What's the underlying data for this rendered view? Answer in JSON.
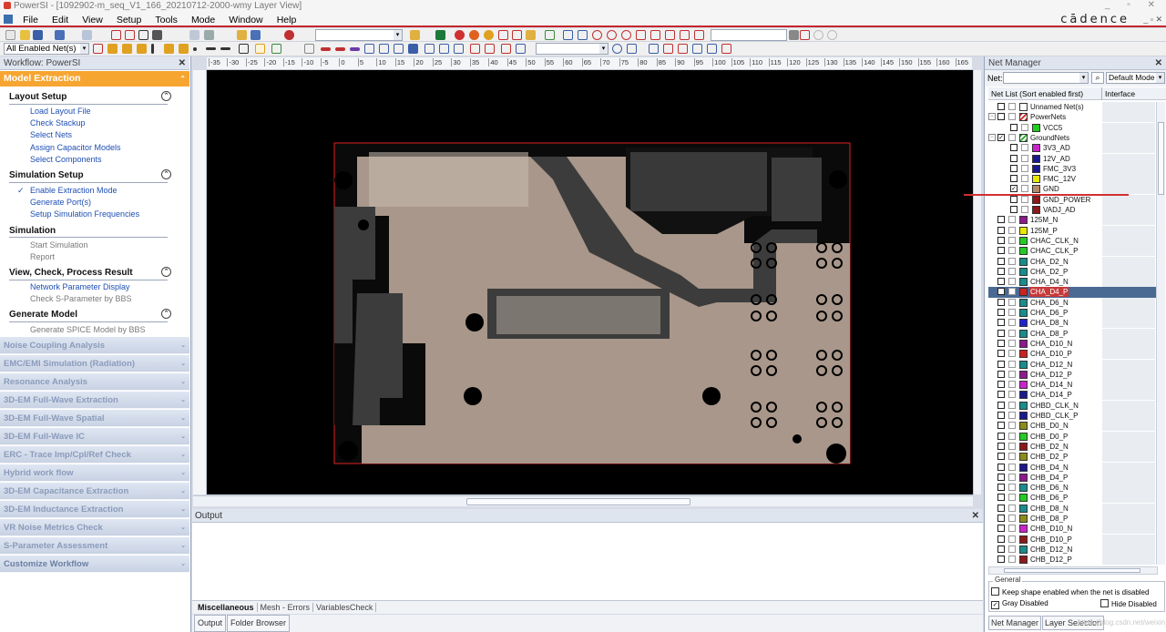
{
  "window": {
    "title": "PowerSI - [1092902-m_seq_V1_166_20210712-2000-wmy Layer View]",
    "controls": "_ ▫ ✕"
  },
  "menubar": {
    "items": [
      "File",
      "Edit",
      "View",
      "Setup",
      "Tools",
      "Mode",
      "Window",
      "Help"
    ],
    "brand": "cādence",
    "brand_controls": "_ ▫ ✕"
  },
  "toolbar": {
    "net_filter": "All Enabled Net(s)"
  },
  "workflow": {
    "header": "Workflow: PowerSI",
    "active": "Model Extraction",
    "sections": [
      {
        "title": "Layout Setup",
        "items": [
          "Load Layout File",
          "Check Stackup",
          "Select Nets",
          "Assign Capacitor Models",
          "Select Components"
        ]
      },
      {
        "title": "Simulation Setup",
        "items": [
          "Enable Extraction Mode",
          "Generate Port(s)",
          "Setup Simulation Frequencies"
        ]
      },
      {
        "title": "Simulation",
        "items": [
          "Start Simulation",
          "Report"
        ]
      },
      {
        "title": "View, Check, Process Result",
        "items": [
          "Network Parameter Display",
          "Check S-Parameter by BBS"
        ]
      },
      {
        "title": "Generate Model",
        "items": [
          "Generate SPICE Model by BBS"
        ]
      }
    ],
    "collapsed": [
      "Noise Coupling Analysis",
      "EMC/EMI Simulation (Radiation)",
      "Resonance Analysis",
      "3D-EM Full-Wave Extraction",
      "3D-EM Full-Wave Spatial",
      "3D-EM Full-Wave IC",
      "ERC - Trace Imp/Cpl/Ref Check",
      "Hybrid work flow",
      "3D-EM Capacitance Extraction",
      "3D-EM Inductance Extraction",
      "VR Noise Metrics Check",
      "S-Parameter Assessment",
      "Customize Workflow"
    ]
  },
  "ruler": {
    "ticks": [
      "-35",
      "-30",
      "-25",
      "-20",
      "-15",
      "-10",
      "-5",
      "0",
      "5",
      "10",
      "15",
      "20",
      "25",
      "30",
      "35",
      "40",
      "45",
      "50",
      "55",
      "60",
      "65",
      "70",
      "75",
      "80",
      "85",
      "90",
      "95",
      "100",
      "105",
      "110",
      "115",
      "120",
      "125",
      "130",
      "135",
      "140",
      "145",
      "150",
      "155",
      "160",
      "165"
    ]
  },
  "output": {
    "title": "Output",
    "subtabs": [
      "Miscellaneous",
      "Mesh - Errors",
      "VariablesCheck"
    ],
    "tabs": [
      "Output",
      "Folder Browser"
    ]
  },
  "net_manager": {
    "title": "Net Manager",
    "net_label": "Net:",
    "mode": "Default Mode",
    "col_list": "Net List (Sort enabled first)",
    "col_interface": "Interface",
    "nets": [
      {
        "name": "Unnamed Net(s)",
        "color": "#ffffff",
        "level": 0,
        "tog": "",
        "checked": false,
        "striped": true
      },
      {
        "name": "PowerNets",
        "color": "#d42020",
        "level": 0,
        "tog": "⊟",
        "checked": false,
        "striped": true
      },
      {
        "name": "VCC5",
        "color": "#22cc22",
        "level": 1,
        "tog": "",
        "checked": false,
        "striped": false
      },
      {
        "name": "GroundNets",
        "color": "#22aa22",
        "level": 0,
        "tog": "⊟",
        "checked": true,
        "striped": true
      },
      {
        "name": "3V3_AD",
        "color": "#cc22cc",
        "level": 1,
        "tog": "",
        "checked": false,
        "striped": false
      },
      {
        "name": "12V_AD",
        "color": "#1a1a8c",
        "level": 1,
        "tog": "",
        "checked": false,
        "striped": false
      },
      {
        "name": "FMC_3V3",
        "color": "#1a1a8c",
        "level": 1,
        "tog": "",
        "checked": false,
        "striped": false
      },
      {
        "name": "FMC_12V",
        "color": "#e8e800",
        "level": 1,
        "tog": "",
        "checked": false,
        "striped": false
      },
      {
        "name": "GND",
        "color": "#b38a6a",
        "level": 1,
        "tog": "",
        "checked": true,
        "striped": false
      },
      {
        "name": "GND_POWER",
        "color": "#8c1a1a",
        "level": 1,
        "tog": "",
        "checked": false,
        "striped": false
      },
      {
        "name": "VADJ_AD",
        "color": "#8c1a1a",
        "level": 1,
        "tog": "",
        "checked": false,
        "striped": false
      },
      {
        "name": "125M_N",
        "color": "#8c1a8c",
        "level": 0,
        "tog": "",
        "checked": false,
        "striped": false
      },
      {
        "name": "125M_P",
        "color": "#e8e800",
        "level": 0,
        "tog": "",
        "checked": false,
        "striped": false
      },
      {
        "name": "CHAC_CLK_N",
        "color": "#22cc22",
        "level": 0,
        "tog": "",
        "checked": false,
        "striped": false
      },
      {
        "name": "CHAC_CLK_P",
        "color": "#22cc22",
        "level": 0,
        "tog": "",
        "checked": false,
        "striped": false
      },
      {
        "name": "CHA_D2_N",
        "color": "#1a8c8c",
        "level": 0,
        "tog": "",
        "checked": false,
        "striped": false
      },
      {
        "name": "CHA_D2_P",
        "color": "#1a8c8c",
        "level": 0,
        "tog": "",
        "checked": false,
        "striped": false
      },
      {
        "name": "CHA_D4_N",
        "color": "#1a8c8c",
        "level": 0,
        "tog": "",
        "checked": false,
        "striped": false
      },
      {
        "name": "CHA_D4_P",
        "color": "#cc2222",
        "level": 0,
        "tog": "",
        "checked": false,
        "striped": false,
        "selected": true
      },
      {
        "name": "CHA_D6_N",
        "color": "#1a8c8c",
        "level": 0,
        "tog": "",
        "checked": false,
        "striped": false
      },
      {
        "name": "CHA_D6_P",
        "color": "#1a8c8c",
        "level": 0,
        "tog": "",
        "checked": false,
        "striped": false
      },
      {
        "name": "CHA_D8_N",
        "color": "#2222cc",
        "level": 0,
        "tog": "",
        "checked": false,
        "striped": false
      },
      {
        "name": "CHA_D8_P",
        "color": "#1a8c8c",
        "level": 0,
        "tog": "",
        "checked": false,
        "striped": false
      },
      {
        "name": "CHA_D10_N",
        "color": "#8c1a8c",
        "level": 0,
        "tog": "",
        "checked": false,
        "striped": false
      },
      {
        "name": "CHA_D10_P",
        "color": "#cc2222",
        "level": 0,
        "tog": "",
        "checked": false,
        "striped": false
      },
      {
        "name": "CHA_D12_N",
        "color": "#1a8c8c",
        "level": 0,
        "tog": "",
        "checked": false,
        "striped": false
      },
      {
        "name": "CHA_D12_P",
        "color": "#8c1a8c",
        "level": 0,
        "tog": "",
        "checked": false,
        "striped": false
      },
      {
        "name": "CHA_D14_N",
        "color": "#cc22cc",
        "level": 0,
        "tog": "",
        "checked": false,
        "striped": false
      },
      {
        "name": "CHA_D14_P",
        "color": "#1a1a8c",
        "level": 0,
        "tog": "",
        "checked": false,
        "striped": false
      },
      {
        "name": "CHBD_CLK_N",
        "color": "#1a8c8c",
        "level": 0,
        "tog": "",
        "checked": false,
        "striped": false
      },
      {
        "name": "CHBD_CLK_P",
        "color": "#1a1a8c",
        "level": 0,
        "tog": "",
        "checked": false,
        "striped": false
      },
      {
        "name": "CHB_D0_N",
        "color": "#8c8c1a",
        "level": 0,
        "tog": "",
        "checked": false,
        "striped": false
      },
      {
        "name": "CHB_D0_P",
        "color": "#22cc22",
        "level": 0,
        "tog": "",
        "checked": false,
        "striped": false
      },
      {
        "name": "CHB_D2_N",
        "color": "#8c1a1a",
        "level": 0,
        "tog": "",
        "checked": false,
        "striped": false
      },
      {
        "name": "CHB_D2_P",
        "color": "#8c8c1a",
        "level": 0,
        "tog": "",
        "checked": false,
        "striped": false
      },
      {
        "name": "CHB_D4_N",
        "color": "#1a1a8c",
        "level": 0,
        "tog": "",
        "checked": false,
        "striped": false
      },
      {
        "name": "CHB_D4_P",
        "color": "#8c1a8c",
        "level": 0,
        "tog": "",
        "checked": false,
        "striped": false
      },
      {
        "name": "CHB_D6_N",
        "color": "#1a8c8c",
        "level": 0,
        "tog": "",
        "checked": false,
        "striped": false
      },
      {
        "name": "CHB_D6_P",
        "color": "#22cc22",
        "level": 0,
        "tog": "",
        "checked": false,
        "striped": false
      },
      {
        "name": "CHB_D8_N",
        "color": "#1a8c8c",
        "level": 0,
        "tog": "",
        "checked": false,
        "striped": false
      },
      {
        "name": "CHB_D8_P",
        "color": "#8c8c1a",
        "level": 0,
        "tog": "",
        "checked": false,
        "striped": false
      },
      {
        "name": "CHB_D10_N",
        "color": "#cc22cc",
        "level": 0,
        "tog": "",
        "checked": false,
        "striped": false
      },
      {
        "name": "CHB_D10_P",
        "color": "#8c1a1a",
        "level": 0,
        "tog": "",
        "checked": false,
        "striped": false
      },
      {
        "name": "CHB_D12_N",
        "color": "#1a8c8c",
        "level": 0,
        "tog": "",
        "checked": false,
        "striped": false
      },
      {
        "name": "CHB_D12_P",
        "color": "#8c1a1a",
        "level": 0,
        "tog": "",
        "checked": false,
        "striped": false
      }
    ],
    "general": {
      "legend": "General",
      "keep_shape": "Keep shape enabled when the net is disabled",
      "gray_disabled": "Gray Disabled",
      "hide_disabled": "Hide Disabled"
    },
    "tabs": [
      "Net Manager",
      "Layer Selection"
    ]
  },
  "colors": {
    "accent": "#f7a531",
    "annotation_red": "#d23030",
    "copper": "#a8978a",
    "board_outline": "#e02020",
    "trace_gray": "#3c3c3c"
  },
  "watermark": "https://blog.csdn.net/weixin_43311"
}
